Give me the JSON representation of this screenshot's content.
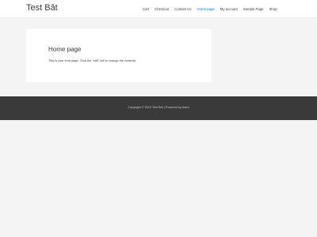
{
  "header": {
    "site_title": "Test Bât",
    "nav": [
      {
        "label": "Cart",
        "active": false
      },
      {
        "label": "Checkout",
        "active": false
      },
      {
        "label": "Contact Us",
        "active": false
      },
      {
        "label": "Home page",
        "active": true
      },
      {
        "label": "My account",
        "active": false
      },
      {
        "label": "Sample Page",
        "active": false
      },
      {
        "label": "Shop",
        "active": false
      }
    ]
  },
  "main": {
    "title": "Home page",
    "body": "This is your front page. Click the \"edit\" link to change the contents"
  },
  "footer": {
    "copyright": "Copyright © 2019 Test Bât | Powered by Astra"
  },
  "colors": {
    "accent": "#0274be",
    "page_background": "#f4f4f4",
    "footer_background": "#3a3a3a"
  }
}
